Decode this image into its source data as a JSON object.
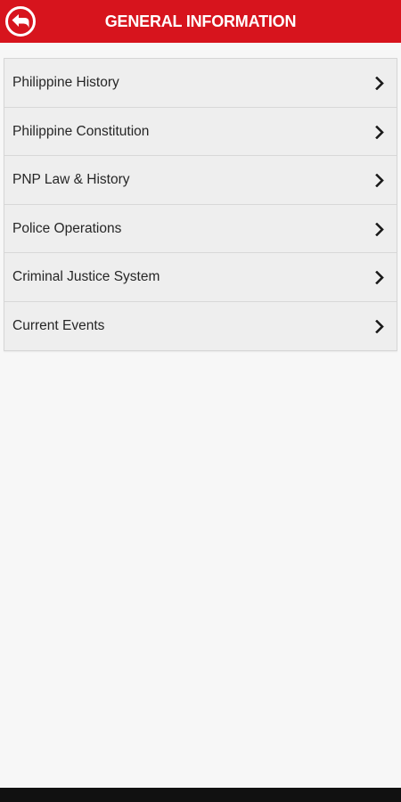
{
  "header": {
    "title": "GENERAL INFORMATION",
    "back_icon": "back-arrow-icon",
    "background_color": "#d7141d",
    "title_color": "#ffffff"
  },
  "menu": {
    "items": [
      {
        "label": "Philippine History",
        "icon": "chevron-right-icon"
      },
      {
        "label": "Philippine Constitution",
        "icon": "chevron-right-icon"
      },
      {
        "label": "PNP Law & History",
        "icon": "chevron-right-icon"
      },
      {
        "label": "Police Operations",
        "icon": "chevron-right-icon"
      },
      {
        "label": "Criminal Justice System",
        "icon": "chevron-right-icon"
      },
      {
        "label": "Current Events",
        "icon": "chevron-right-icon"
      }
    ]
  }
}
